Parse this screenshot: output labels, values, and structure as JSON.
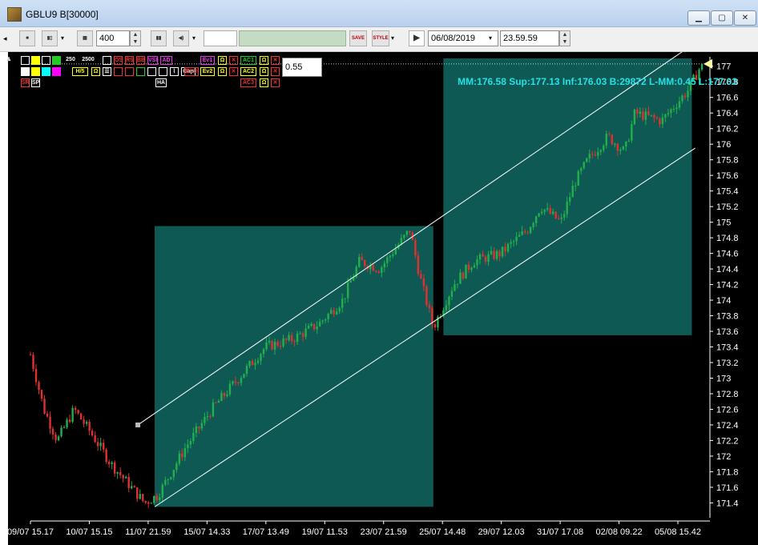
{
  "window": {
    "title": "GBLU9 B[30000]"
  },
  "toolbar": {
    "bars_count": "400",
    "date": "06/08/2019",
    "time": "23.59.59",
    "save_label": "SAVE",
    "style_label": "STYLE"
  },
  "indicators": {
    "n1": "250",
    "n2": "2500",
    "value": "0.55",
    "labels": [
      "OS",
      "RS",
      "BB",
      "VSI",
      "AD",
      "Ev1",
      "AC1",
      "H/5",
      "Gap",
      "BLD",
      "Ev2",
      "AC2",
      "AC3",
      "SR",
      "SP",
      "HA"
    ]
  },
  "info_line": "MM:176.58 Sup:177.13 Inf:176.03 B:29872 L-MM:0.45 L:177.03",
  "colors": {
    "up": "#22b04a",
    "down": "#e03030",
    "box": "#0f5955",
    "info": "#26e0e6"
  },
  "chart_data": {
    "type": "candlestick",
    "ylim": [
      171.25,
      177.1
    ],
    "y_ticks": [
      177,
      176.8,
      176.6,
      176.4,
      176.2,
      176,
      175.8,
      175.6,
      175.4,
      175.2,
      175,
      174.8,
      174.6,
      174.4,
      174.2,
      174,
      173.8,
      173.6,
      173.4,
      173.2,
      173,
      172.8,
      172.6,
      172.4,
      172.2,
      172,
      171.8,
      171.6,
      171.4
    ],
    "x_labels": [
      "09/07 15.17",
      "10/07 15.15",
      "11/07 21.59",
      "15/07 14.33",
      "17/07 13.49",
      "19/07 11.53",
      "23/07 21.59",
      "25/07 14.48",
      "29/07 12.03",
      "31/07 17.08",
      "02/08 09.22",
      "05/08 15.42"
    ],
    "last": 177.03,
    "path_points": [
      [
        0,
        173.3
      ],
      [
        0.02,
        172.6
      ],
      [
        0.04,
        172.2
      ],
      [
        0.065,
        172.6
      ],
      [
        0.09,
        172.3
      ],
      [
        0.12,
        171.9
      ],
      [
        0.14,
        171.7
      ],
      [
        0.17,
        171.4
      ],
      [
        0.19,
        171.5
      ],
      [
        0.23,
        172.1
      ],
      [
        0.27,
        172.6
      ],
      [
        0.31,
        173.0
      ],
      [
        0.35,
        173.4
      ],
      [
        0.39,
        173.5
      ],
      [
        0.43,
        173.7
      ],
      [
        0.465,
        174.0
      ],
      [
        0.49,
        174.5
      ],
      [
        0.52,
        174.4
      ],
      [
        0.565,
        174.9
      ],
      [
        0.58,
        174.3
      ],
      [
        0.6,
        173.65
      ],
      [
        0.63,
        174.2
      ],
      [
        0.66,
        174.5
      ],
      [
        0.7,
        174.6
      ],
      [
        0.74,
        174.9
      ],
      [
        0.76,
        175.2
      ],
      [
        0.79,
        175.0
      ],
      [
        0.81,
        175.5
      ],
      [
        0.83,
        175.8
      ],
      [
        0.86,
        176.1
      ],
      [
        0.885,
        175.9
      ],
      [
        0.9,
        176.4
      ],
      [
        0.94,
        176.3
      ],
      [
        0.96,
        176.5
      ],
      [
        0.98,
        176.7
      ],
      [
        1,
        177.03
      ]
    ],
    "boxes": [
      {
        "x0": 0.185,
        "x1": 0.6,
        "y0": 171.35,
        "y1": 174.95
      },
      {
        "x0": 0.615,
        "x1": 0.985,
        "y0": 173.55,
        "y1": 177.1
      }
    ],
    "channel": {
      "upper": [
        [
          0.16,
          172.4
        ],
        [
          0.99,
          177.3
        ]
      ],
      "lower": [
        [
          0.185,
          171.35
        ],
        [
          0.99,
          175.95
        ]
      ]
    }
  }
}
